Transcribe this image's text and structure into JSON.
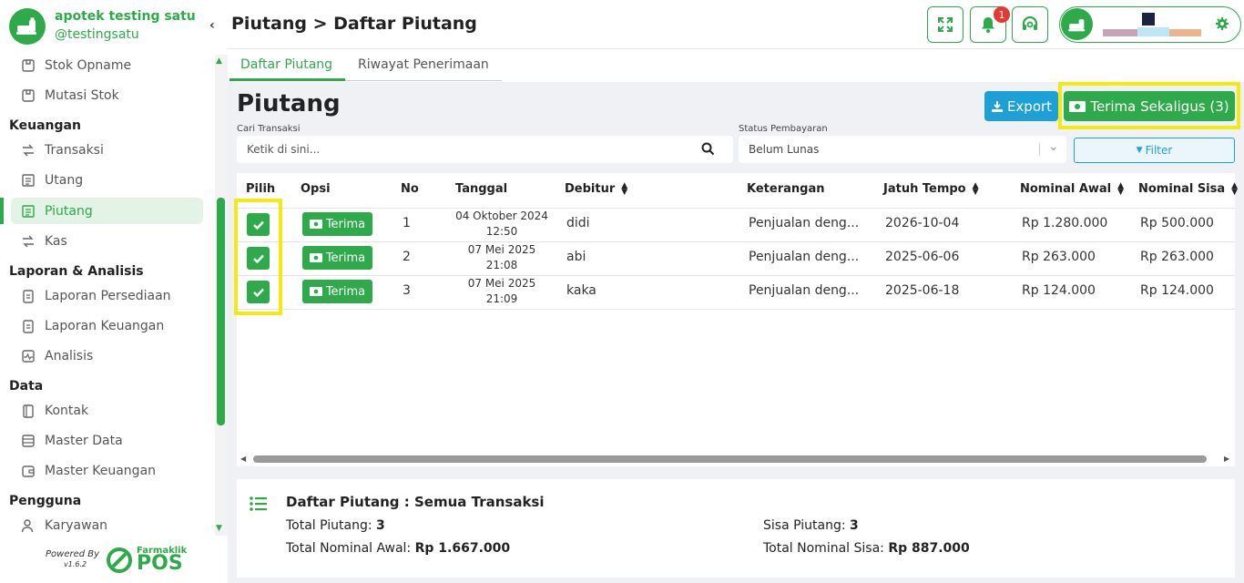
{
  "sidebar": {
    "store_name": "apotek testing satu",
    "store_handle": "@testingsatu",
    "items": [
      {
        "label": "Stok Opname"
      },
      {
        "label": "Mutasi Stok"
      },
      {
        "label": "Transaksi"
      },
      {
        "label": "Utang"
      },
      {
        "label": "Piutang"
      },
      {
        "label": "Kas"
      },
      {
        "label": "Laporan Persediaan"
      },
      {
        "label": "Laporan Keuangan"
      },
      {
        "label": "Analisis"
      },
      {
        "label": "Kontak"
      },
      {
        "label": "Master Data"
      },
      {
        "label": "Master Keuangan"
      },
      {
        "label": "Karyawan"
      }
    ],
    "headings": {
      "keuangan": "Keuangan",
      "laporan": "Laporan & Analisis",
      "data": "Data",
      "pengguna": "Pengguna"
    },
    "powered_by": "Powered By",
    "version": "v1.6.2",
    "brand_small": "Farmaklik",
    "brand_big": "POS"
  },
  "header": {
    "breadcrumb": "Piutang > Daftar Piutang",
    "notif_count": "1"
  },
  "tabs": [
    {
      "label": "Daftar Piutang"
    },
    {
      "label": "Riwayat Penerimaan"
    }
  ],
  "main": {
    "title": "Piutang",
    "export_label": "Export",
    "terima_all_label": "Terima Sekaligus (3)",
    "search_label": "Cari Transaksi",
    "search_placeholder": "Ketik di sini...",
    "status_label": "Status Pembayaran",
    "status_value": "Belum Lunas",
    "filter_label": "Filter"
  },
  "table": {
    "headers": {
      "pilih": "Pilih",
      "opsi": "Opsi",
      "no": "No",
      "tanggal": "Tanggal",
      "debitur": "Debitur",
      "keterangan": "Keterangan",
      "jatuh_tempo": "Jatuh Tempo",
      "nominal_awal": "Nominal Awal",
      "nominal_sisa": "Nominal Sisa"
    },
    "terima_label": "Terima",
    "rows": [
      {
        "no": "1",
        "date": "04 Oktober 2024",
        "time": "12:50",
        "debitur": "didi",
        "keterangan": "Penjualan deng...",
        "jatuh_tempo": "2026-10-04",
        "nominal_awal": "Rp 1.280.000",
        "nominal_sisa": "Rp 500.000",
        "checked": true
      },
      {
        "no": "2",
        "date": "07 Mei 2025",
        "time": "21:08",
        "debitur": "abi",
        "keterangan": "Penjualan deng...",
        "jatuh_tempo": "2025-06-06",
        "nominal_awal": "Rp 263.000",
        "nominal_sisa": "Rp 263.000",
        "checked": true
      },
      {
        "no": "3",
        "date": "07 Mei 2025",
        "time": "21:09",
        "debitur": "kaka",
        "keterangan": "Penjualan deng...",
        "jatuh_tempo": "2025-06-18",
        "nominal_awal": "Rp 124.000",
        "nominal_sisa": "Rp 124.000",
        "checked": true
      }
    ]
  },
  "summary": {
    "title": "Daftar Piutang : Semua Transaksi",
    "total_piutang_label": "Total Piutang:",
    "total_piutang_value": "3",
    "sisa_piutang_label": "Sisa Piutang:",
    "sisa_piutang_value": "3",
    "total_awal_label": "Total Nominal Awal:",
    "total_awal_value": "Rp 1.667.000",
    "total_sisa_label": "Total Nominal Sisa:",
    "total_sisa_value": "Rp 887.000"
  },
  "colors": {
    "accent": "#2eaa4a",
    "export": "#1da0d6",
    "highlight": "#f2ea14",
    "badge": "#e53935"
  }
}
